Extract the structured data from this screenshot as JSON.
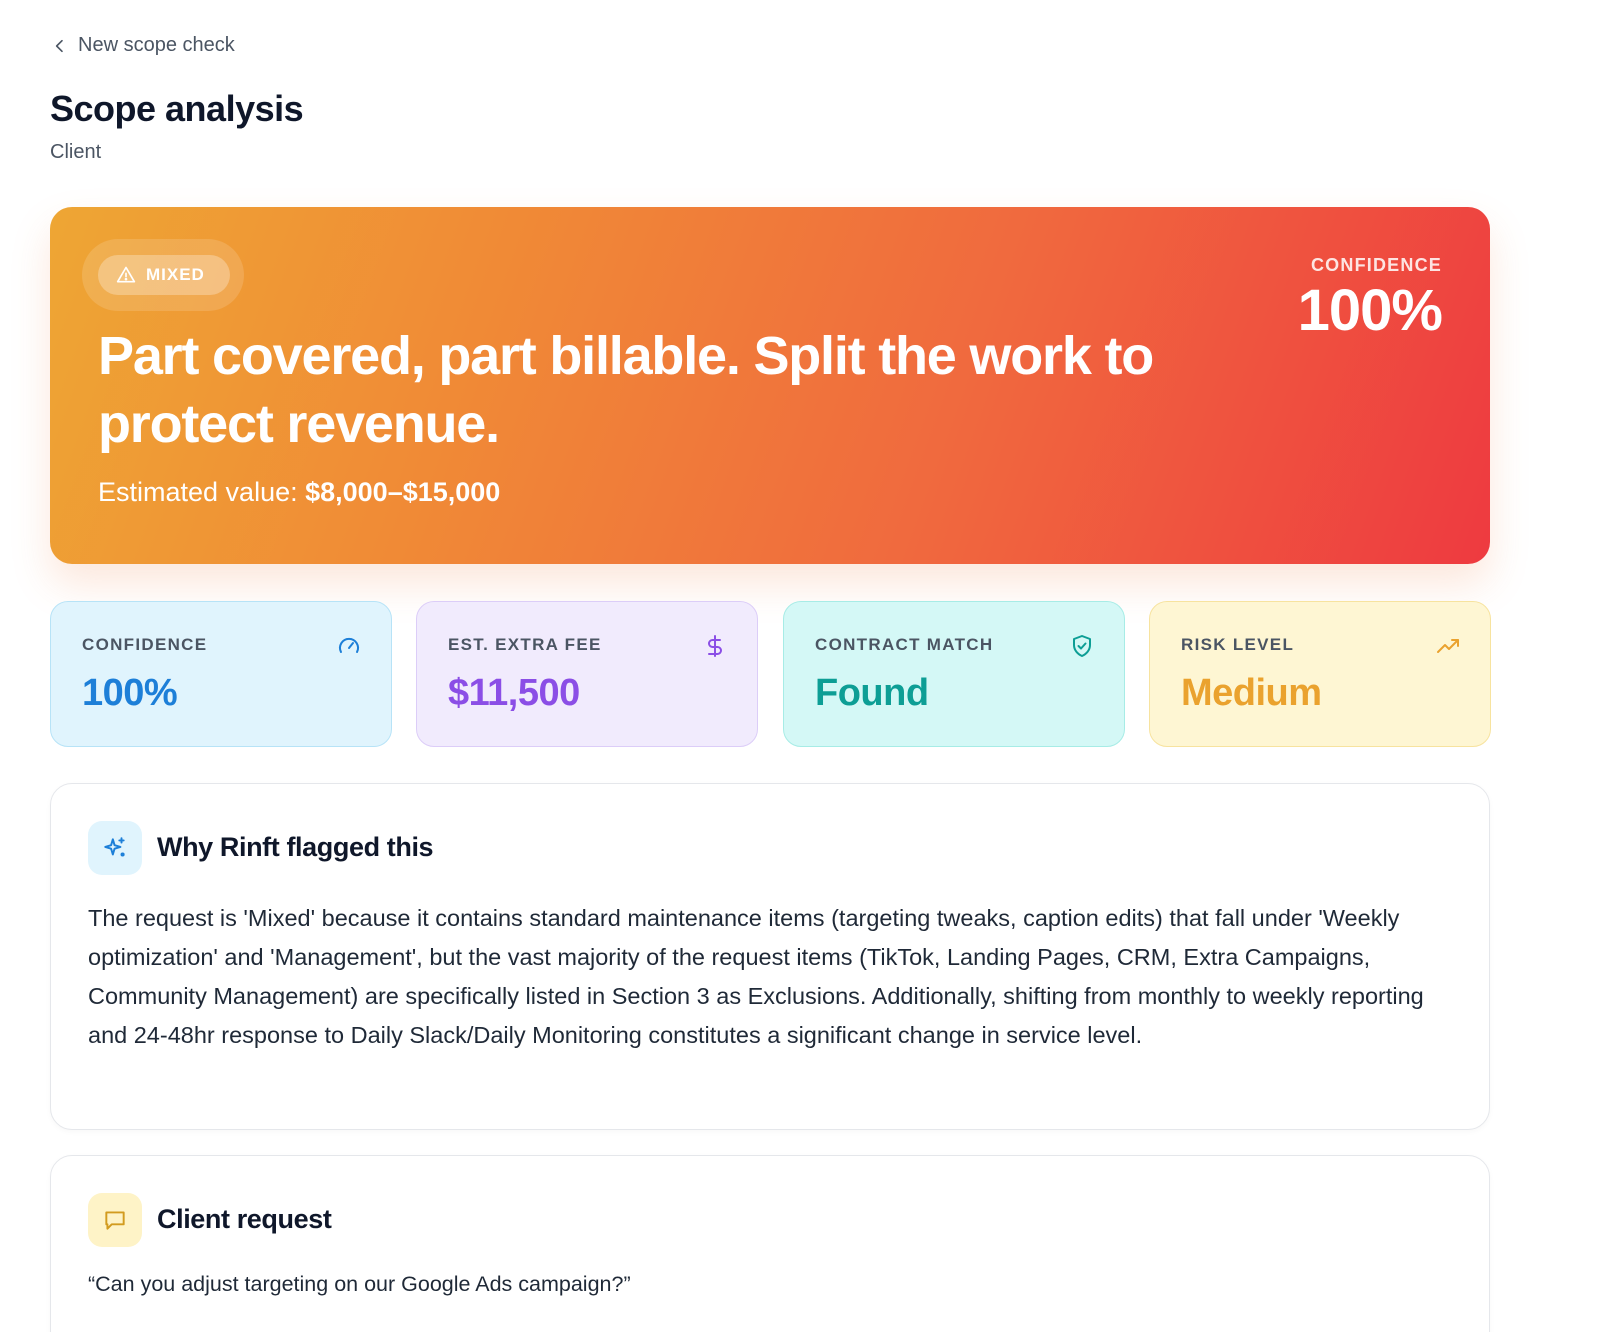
{
  "nav": {
    "back_label": "New scope check"
  },
  "header": {
    "title": "Scope analysis",
    "subtitle": "Client"
  },
  "hero": {
    "badge": "MIXED",
    "headline": "Part covered, part billable. Split the work to protect revenue.",
    "value_prefix": "Estimated value: ",
    "value_range": "$8,000–$15,000",
    "confidence_label": "CONFIDENCE",
    "confidence_value": "100%"
  },
  "stats": [
    {
      "label": "CONFIDENCE",
      "value": "100%",
      "icon": "gauge-icon",
      "color": "#1d7fd8"
    },
    {
      "label": "EST. EXTRA FEE",
      "value": "$11,500",
      "icon": "dollar-icon",
      "color": "#8b4ee6"
    },
    {
      "label": "CONTRACT MATCH",
      "value": "Found",
      "icon": "shield-check-icon",
      "color": "#0d9e95"
    },
    {
      "label": "RISK LEVEL",
      "value": "Medium",
      "icon": "trending-up-icon",
      "color": "#eaa22e"
    }
  ],
  "why": {
    "title": "Why Rinft flagged this",
    "body": "The request is 'Mixed' because it contains standard maintenance items (targeting tweaks, caption edits) that fall under 'Weekly optimization' and 'Management', but the vast majority of the request items (TikTok, Landing Pages, CRM, Extra Campaigns, Community Management) are specifically listed in Section 3 as Exclusions. Additionally, shifting from monthly to weekly reporting and 24-48hr response to Daily Slack/Daily Monitoring constitutes a significant change in service level."
  },
  "request": {
    "title": "Client request",
    "body": "“Can you adjust targeting on our Google Ads campaign?”"
  }
}
